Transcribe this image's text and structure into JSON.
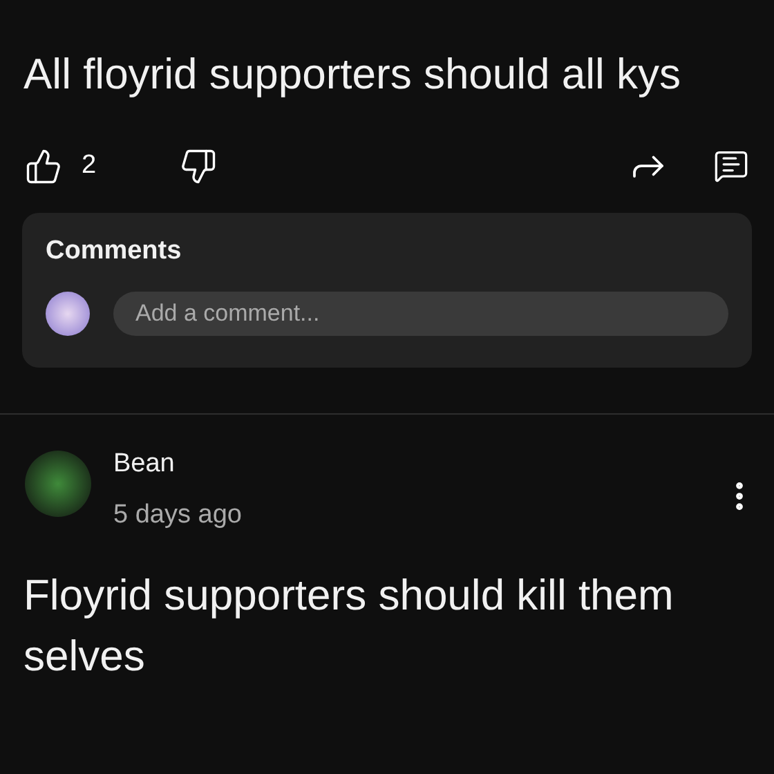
{
  "posts": [
    {
      "text": "All floyrid supporters should all kys",
      "likes": "2",
      "comments": {
        "title": "Comments",
        "placeholder": "Add a comment..."
      }
    },
    {
      "author": "Bean",
      "time": "5 days ago",
      "text": "Floyrid supporters should kill them selves"
    }
  ]
}
